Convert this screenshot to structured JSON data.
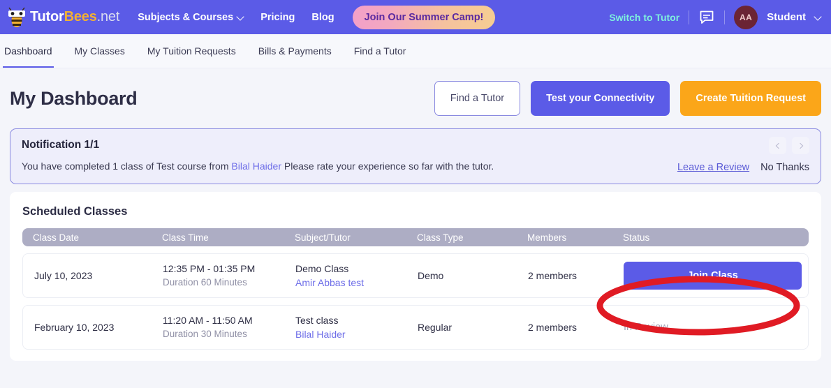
{
  "header": {
    "brand": {
      "part1": "Tutor",
      "part2": "Bees",
      "part3": ".net",
      "icon": "bee-logo-icon"
    },
    "nav": [
      {
        "label": "Subjects & Courses",
        "has_chevron": true
      },
      {
        "label": "Pricing",
        "has_chevron": false
      },
      {
        "label": "Blog",
        "has_chevron": false
      }
    ],
    "cta_label": "Join Our Summer Camp!",
    "switch_link": "Switch to Tutor",
    "chat_icon": "chat-bubble-icon",
    "avatar_initials": "AA",
    "user_label": "Student",
    "accent_purple": "#5b5be7",
    "accent_teal": "#7ef0de",
    "accent_gold": "#f2b134"
  },
  "subnav": {
    "items": [
      {
        "label": "Dashboard",
        "active": true
      },
      {
        "label": "My Classes",
        "active": false
      },
      {
        "label": "My Tuition Requests",
        "active": false
      },
      {
        "label": "Bills & Payments",
        "active": false
      },
      {
        "label": "Find a Tutor",
        "active": false
      }
    ]
  },
  "page": {
    "title": "My Dashboard",
    "actions": {
      "find_tutor": "Find a Tutor",
      "test_connectivity": "Test your Connectivity",
      "create_request": "Create Tuition Request"
    }
  },
  "notification": {
    "title": "Notification 1/1",
    "text_before": "You have completed 1 class of Test course from ",
    "tutor_link": "Bilal Haider",
    "text_after": " Please rate your experience so far with the tutor.",
    "review_link": "Leave a Review",
    "dismiss_label": "No Thanks",
    "prev_icon": "chevron-left-icon",
    "next_icon": "chevron-right-icon"
  },
  "scheduled": {
    "title": "Scheduled Classes",
    "columns": [
      "Class Date",
      "Class Time",
      "Subject/Tutor",
      "Class Type",
      "Members",
      "Status"
    ],
    "rows": [
      {
        "date": "July 10, 2023",
        "time": "12:35 PM - 01:35 PM",
        "duration": "Duration 60 Minutes",
        "subject": "Demo Class",
        "tutor": "Amir Abbas test",
        "type": "Demo",
        "members": "2 members",
        "status_label": "Join Class",
        "status_kind": "button"
      },
      {
        "date": "February 10, 2023",
        "time": "11:20 AM - 11:50 AM",
        "duration": "Duration 30 Minutes",
        "subject": "Test class",
        "tutor": "Bilal Haider",
        "type": "Regular",
        "members": "2 members",
        "status_label": "In Review",
        "status_kind": "text"
      }
    ]
  },
  "annotation": {
    "shape": "red-ellipse-highlight",
    "color": "#e01b24"
  }
}
